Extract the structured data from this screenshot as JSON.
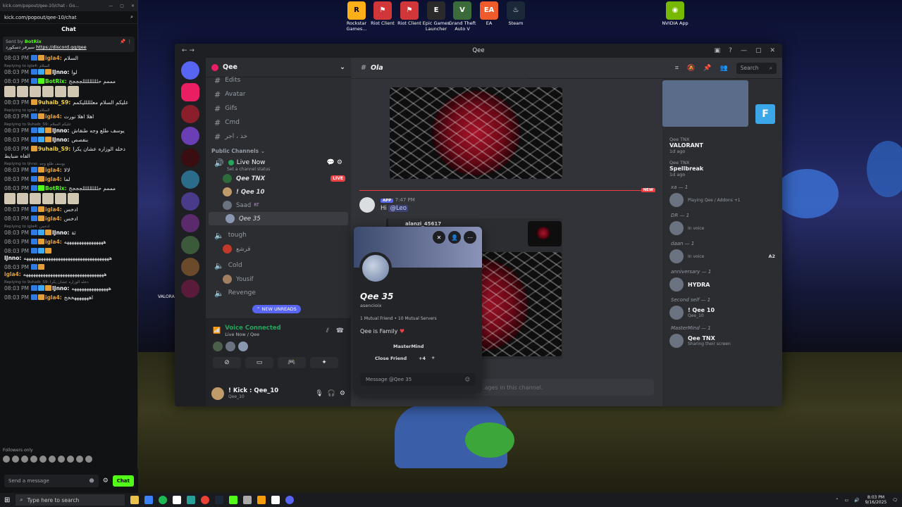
{
  "desktop": {
    "icons": [
      {
        "label": "Rockstar Games...",
        "name": "rockstar-icon",
        "color": "#fcaf17",
        "glyph": "R"
      },
      {
        "label": "Riot Client",
        "name": "riot-client-icon",
        "color": "#d13639",
        "glyph": "⚑"
      },
      {
        "label": "Riot Client",
        "name": "riot-client-icon-2",
        "color": "#d13639",
        "glyph": "⚑"
      },
      {
        "label": "Epic Games Launcher",
        "name": "epic-games-icon",
        "color": "#2a2a2a",
        "glyph": "E"
      },
      {
        "label": "Grand Theft Auto V",
        "name": "gta-icon",
        "color": "#3b6b3b",
        "glyph": "V"
      },
      {
        "label": "EA",
        "name": "ea-icon",
        "color": "#ef5b2b",
        "glyph": "EA"
      },
      {
        "label": "Steam",
        "name": "steam-icon",
        "color": "#1b2838",
        "glyph": "♨"
      },
      {
        "label": "NVIDIA App",
        "name": "nvidia-icon",
        "color": "#76b900",
        "glyph": "◉"
      }
    ],
    "valorant_label": "VALORA"
  },
  "kick": {
    "url": "kick.com/popout/qee-10/chat - Go...",
    "search_text": "kick.com/popout/qee-10/chat",
    "title": "Chat",
    "pinned_sender": "Sent by",
    "pinned_bot": "BotRix",
    "pinned_text": "سيرفر دسكورد",
    "pinned_link": "https://discord.gg/qee",
    "messages": [
      {
        "reply": "",
        "time": "08:03 PM",
        "user": "igla4:",
        "color": "#e3a03a",
        "text": "السلام",
        "badges": [
          "#2f7be0",
          "#e3a03a"
        ]
      },
      {
        "reply": "Replying to igla4: السلام",
        "time": "08:03 PM",
        "user": "IJnno:",
        "color": "#ffffff",
        "text": "لوا",
        "badges": [
          "#2f7be0",
          "#3ea9f5",
          "#e3a03a"
        ]
      },
      {
        "reply": "",
        "time": "08:03 PM",
        "user": "BotRix:",
        "color": "#53fc18",
        "text": "مممم حلللللللللجججج",
        "badges": [
          "#2f7be0",
          "#53fc18"
        ],
        "emotes": 6
      },
      {
        "reply": "",
        "time": "08:03 PM",
        "user": "9uhaib_S9:",
        "color": "#f5d442",
        "text": "عليكم السلام معللللليكمم",
        "badges": [
          "#e3a03a"
        ]
      },
      {
        "reply": "Replying to igla4: السلام",
        "time": "08:03 PM",
        "user": "igla4:",
        "color": "#e3a03a",
        "text": "اهلا اهلا نورت",
        "badges": [
          "#2f7be0",
          "#e3a03a"
        ]
      },
      {
        "reply": "Replying to 9uhaib_S9: عليكم السلام",
        "time": "08:03 PM",
        "user": "IJnno:",
        "color": "#ffffff",
        "text": "يوسف طلع وجه طنقاش",
        "badges": [
          "#2f7be0",
          "#3ea9f5",
          "#e3a03a"
        ]
      },
      {
        "reply": "",
        "time": "08:03 PM",
        "user": "IJnno:",
        "color": "#ffffff",
        "text": "بنفصص",
        "badges": [
          "#2f7be0",
          "#3ea9f5",
          "#e3a03a"
        ]
      },
      {
        "reply": "",
        "time": "08:03 PM",
        "user": "9uhaib_S9:",
        "color": "#f5d442",
        "text": "دخله الوزاره عشان يكرا الفاه ضبايط",
        "badges": [
          "#e3a03a"
        ]
      },
      {
        "reply": "Replying to IJnno: يوسف طلع وجه",
        "time": "08:03 PM",
        "user": "igla4:",
        "color": "#e3a03a",
        "text": "لالا",
        "badges": [
          "#2f7be0",
          "#e3a03a"
        ]
      },
      {
        "reply": "",
        "time": "08:03 PM",
        "user": "igla4:",
        "color": "#e3a03a",
        "text": "لما",
        "badges": [
          "#2f7be0",
          "#e3a03a"
        ]
      },
      {
        "reply": "",
        "time": "08:03 PM",
        "user": "BotRix:",
        "color": "#53fc18",
        "text": "مممم حلللللللللجججج",
        "badges": [
          "#2f7be0",
          "#53fc18"
        ],
        "emotes": 6
      },
      {
        "reply": "",
        "time": "08:03 PM",
        "user": "igla4:",
        "color": "#e3a03a",
        "text": "ادخس",
        "badges": [
          "#2f7be0",
          "#e3a03a"
        ]
      },
      {
        "reply": "",
        "time": "08:03 PM",
        "user": "igla4:",
        "color": "#e3a03a",
        "text": "ادخس",
        "badges": [
          "#2f7be0",
          "#e3a03a"
        ]
      },
      {
        "reply": "Replying to igla4: ادخس",
        "time": "08:03 PM",
        "user": "IJnno:",
        "color": "#ffffff",
        "text": "ثة",
        "badges": [
          "#2f7be0",
          "#3ea9f5",
          "#e3a03a"
        ]
      },
      {
        "reply": "",
        "time": "08:03 PM",
        "user": "igla4:",
        "color": "#e3a03a",
        "text": "ههههههههههههههههه",
        "badges": [
          "#2f7be0",
          "#e3a03a"
        ]
      },
      {
        "reply": "",
        "time": "08:03 PM",
        "user": "IJnno:",
        "color": "#ffffff",
        "text": "هههههههههههههههههههههههههههههههههههه",
        "badges": [
          "#2f7be0",
          "#3ea9f5",
          "#e3a03a"
        ]
      },
      {
        "reply": "",
        "time": "08:03 PM",
        "user": "igla4:",
        "color": "#e3a03a",
        "text": "هههههههههههههههههههههههههههههههههه",
        "badges": [
          "#2f7be0",
          "#e3a03a"
        ]
      },
      {
        "reply": "Replying to 9uhaib_S9: دخله الوزاره عشان يكرا",
        "time": "08:03 PM",
        "user": "IJnno:",
        "color": "#ffffff",
        "text": "هههههههههههههههه",
        "badges": [
          "#2f7be0",
          "#3ea9f5",
          "#e3a03a"
        ]
      },
      {
        "reply": "",
        "time": "08:03 PM",
        "user": "igla4:",
        "color": "#e3a03a",
        "text": "اهههههههخخخ",
        "badges": [
          "#2f7be0",
          "#e3a03a"
        ]
      }
    ],
    "followers_only": "Followers only",
    "input_placeholder": "Send a message",
    "chat_button": "Chat"
  },
  "discord": {
    "window_title": "Qee",
    "server_name": "Qee",
    "text_channels": [
      "Edits",
      "Avatar",
      "Gifs",
      "Cmd",
      "خذ ، اجر"
    ],
    "public_category": "Public Channels",
    "live_channel": "Live Now",
    "channel_status": "Set a channel status",
    "voice_users": [
      {
        "name": "Qee TNX",
        "live": true
      },
      {
        "name": "! Qee 10",
        "live": false
      },
      {
        "name": "Saad",
        "tag": "RT",
        "live": false
      },
      {
        "name": "Qee 35",
        "live": false
      }
    ],
    "live_label": "LIVE",
    "voice_channels": [
      {
        "name": "tough",
        "users": [
          "قرشع"
        ]
      },
      {
        "name": "Cold",
        "users": [
          "Yousif"
        ]
      },
      {
        "name": "Revenge",
        "users": []
      }
    ],
    "new_unreads": "NEW UNREADS",
    "voice_connected": "Voice Connected",
    "voice_location": "Live Now / Qee",
    "user_name": "! Kick : Qee_10",
    "user_sub": "Qee_10",
    "channel_name": "Ola",
    "new_tag": "NEW",
    "msg_app": "APP",
    "msg_time": "7:47 PM",
    "msg_text": "Hi",
    "msg_mention": "@Leo",
    "embed_author": "alanzi_45617",
    "input_placeholder": "...ages in this channel.",
    "search_placeholder": "Search",
    "activity": [
      {
        "user": "Qee TNX",
        "game": "VALORANT",
        "time": "1d ago"
      },
      {
        "user": "Qee TNX",
        "game": "Spellbreak",
        "time": "1d ago"
      }
    ],
    "members": [
      {
        "header": "xa — 1",
        "name": "",
        "sub": "Playing Qee / Addons +1"
      },
      {
        "header": "DR — 1",
        "name": "",
        "sub": "In voice"
      },
      {
        "header": "daan — 1",
        "name": "",
        "sub": "In voice",
        "tag": "A2"
      },
      {
        "header": "anniversary — 1",
        "name": "HYDRA",
        "sub": ""
      },
      {
        "header": "Second self — 1",
        "name": "! Qee 10",
        "sub": "Qee_10"
      },
      {
        "header": "MasterMind — 1",
        "name": "Qee TNX",
        "sub": "Sharing their screen"
      }
    ]
  },
  "profile": {
    "name": "Qee 35",
    "tag": "asencioix",
    "mutual": "1 Mutual Friend  •  10 Mutual Servers",
    "bio": "Qee is Family",
    "role1": "MasterMind",
    "role2": "Close Friend",
    "more_roles": "+4",
    "message_placeholder": "Message @Qee 35"
  },
  "taskbar": {
    "search_placeholder": "Type here to search",
    "time": "8:03 PM",
    "date": "9/16/2025"
  }
}
